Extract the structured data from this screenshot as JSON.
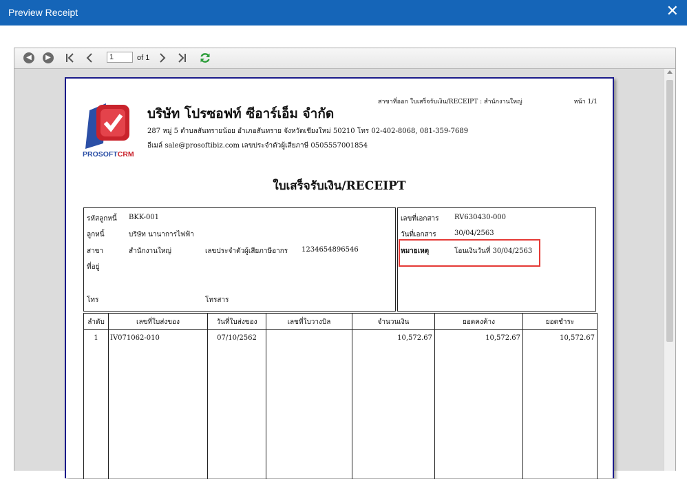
{
  "window": {
    "title": "Preview Receipt",
    "close_glyph": "✕"
  },
  "toolbar": {
    "current_page": "1",
    "of_label": "of 1",
    "icons": [
      "back-icon",
      "forward-icon",
      "first-page-icon",
      "prev-page-icon",
      "next-page-icon",
      "last-page-icon",
      "refresh-icon"
    ]
  },
  "report": {
    "branch_line": "สาขาที่ออก ใบเสร็จรับเงิน/RECEIPT : สำนักงานใหญ่",
    "page_label": "หน้า 1/1",
    "logo_text": "PROSOFT",
    "logo_text_accent": "CRM",
    "company_name": "บริษัท โปรซอฟท์ ซีอาร์เอ็ม จำกัด",
    "address": "287 หมู่ 5 ตำบลสันทรายน้อย อำเภอสันทราย จังหวัดเชียงใหม่ 50210 โทร 02-402-8068, 081-359-7689",
    "email_line": "อีเมล์ sale@prosoftibiz.com เลขประจำตัวผู้เสียภาษี 0505557001854",
    "doc_title": "ใบเสร็จรับเงิน/RECEIPT",
    "customer": {
      "code_label": "รหัสลูกหนี้",
      "code": "BKK-001",
      "name_label": "ลูกหนี้",
      "name": "บริษัท นานาการไฟฟ้า",
      "branch_label": "สาขา",
      "branch": "สำนักงานใหญ่",
      "tax_label": "เลขประจำตัวผู้เสียภาษีอากร",
      "tax_id": "1234654896546",
      "address_label": "ที่อยู่",
      "tel_label": "โทร",
      "fax_label": "โทรสาร"
    },
    "document": {
      "no_label": "เลขที่เอกสาร",
      "no": "RV630430-000",
      "date_label": "วันที่เอกสาร",
      "date": "30/04/2563",
      "remark_label": "หมายเหตุ",
      "remark": "โอนเงินวันที่ 30/04/2563"
    },
    "table": {
      "headers": [
        "ลำดับ",
        "เลขที่ใบส่งของ",
        "วันที่ใบส่งของ",
        "เลขที่ใบวางบิล",
        "จำนวนเงิน",
        "ยอดคงค้าง",
        "ยอดชำระ"
      ],
      "rows": [
        [
          "1",
          "IV071062-010",
          "07/10/2562",
          "",
          "10,572.67",
          "10,572.67",
          "10,572.67"
        ]
      ]
    }
  }
}
